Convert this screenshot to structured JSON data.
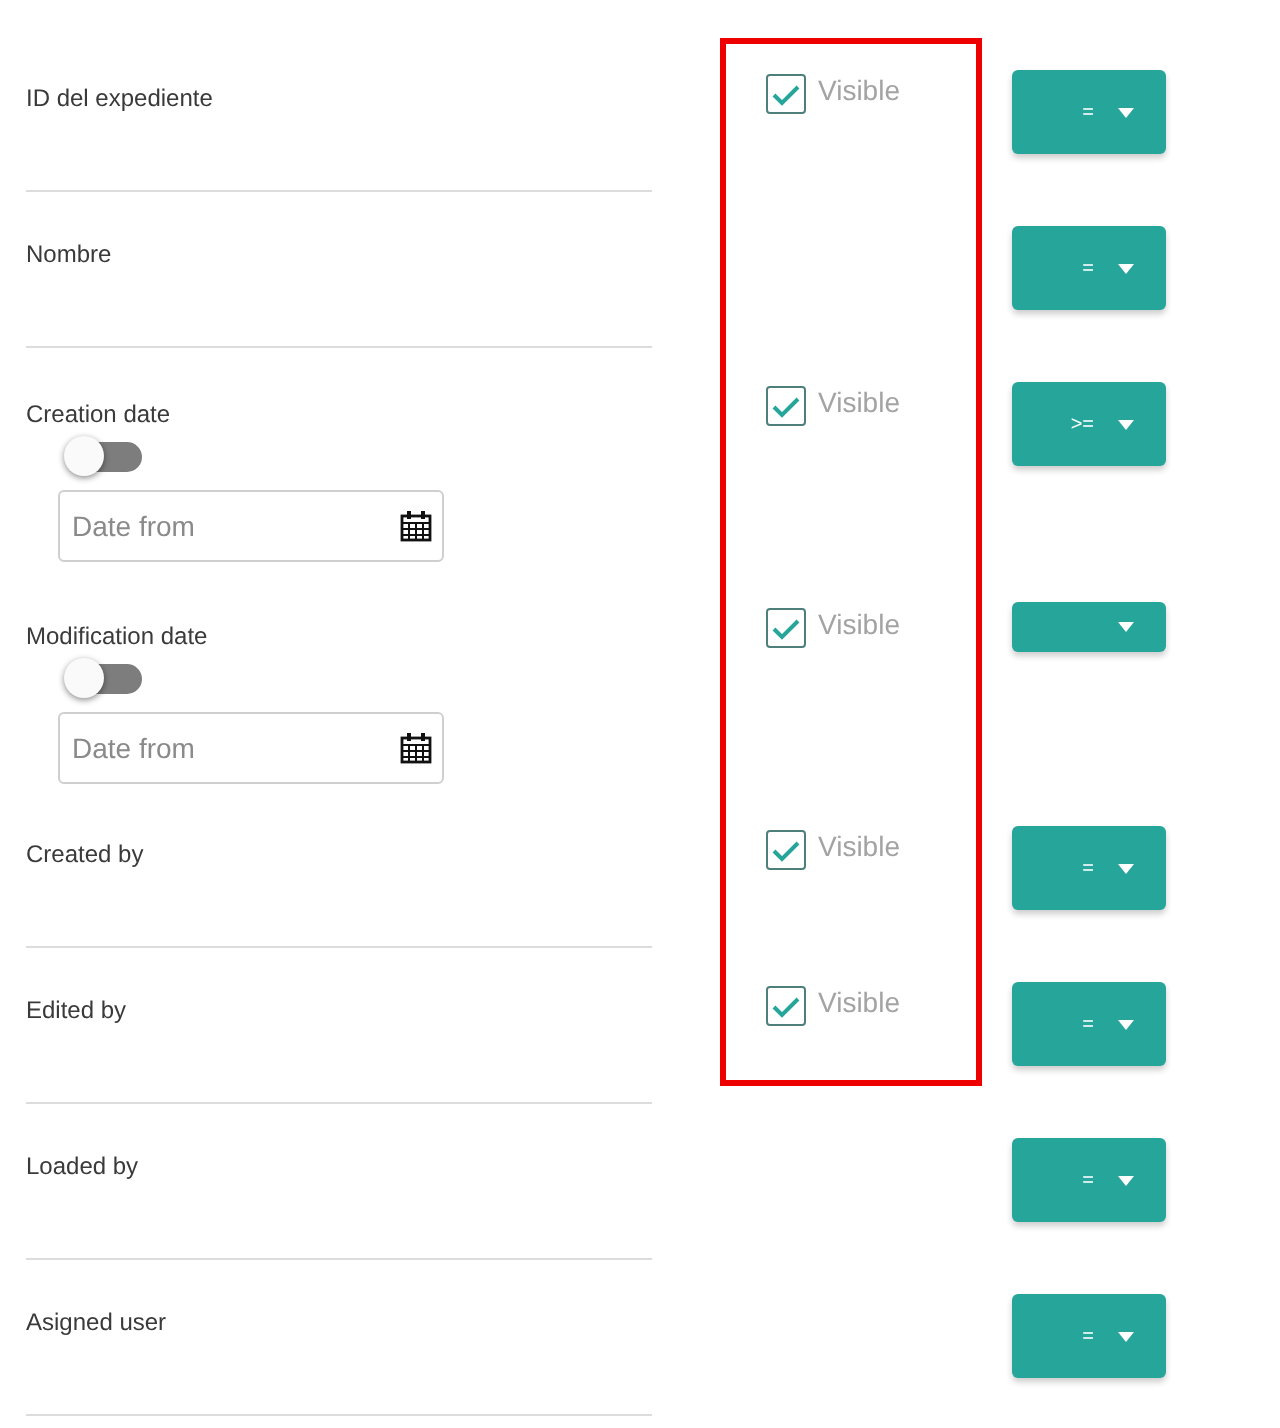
{
  "highlight_frame": {
    "shown": true
  },
  "fields": [
    {
      "kind": "text",
      "label": "ID del expediente",
      "visible_option": {
        "label": "Visible",
        "checked": true
      },
      "operator": "="
    },
    {
      "kind": "text",
      "label": "Nombre",
      "operator": "="
    },
    {
      "kind": "date",
      "label": "Creation date",
      "toggle_on": false,
      "placeholder": "Date from",
      "visible_option": {
        "label": "Visible",
        "checked": true
      },
      "operator": ">="
    },
    {
      "kind": "date",
      "label": "Modification date",
      "toggle_on": false,
      "placeholder": "Date from",
      "visible_option": {
        "label": "Visible",
        "checked": true
      }
    },
    {
      "kind": "text",
      "label": "Created by",
      "visible_option": {
        "label": "Visible",
        "checked": true
      },
      "operator": "="
    },
    {
      "kind": "text",
      "label": "Edited by",
      "visible_option": {
        "label": "Visible",
        "checked": true
      },
      "operator": "="
    },
    {
      "kind": "text",
      "label": "Loaded by",
      "operator": "="
    },
    {
      "kind": "text",
      "label": "Asigned user",
      "operator": "="
    }
  ]
}
